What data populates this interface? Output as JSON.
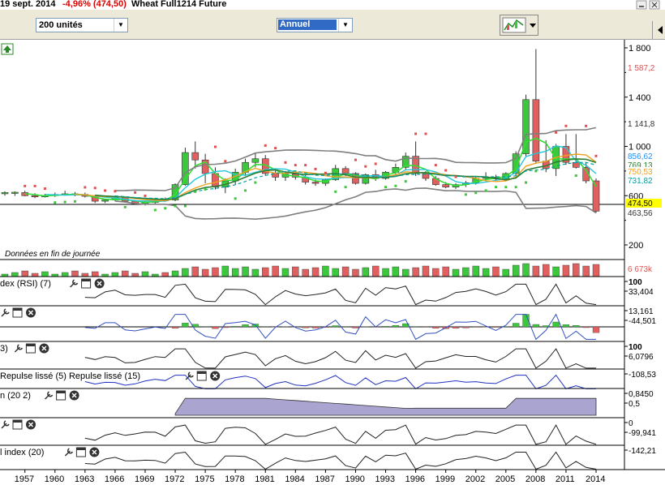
{
  "header": {
    "date": "19 sept. 2014",
    "change": "-4,96% (474,50)",
    "instrument": "Wheat Full1214 Future"
  },
  "toolbar": {
    "units_select": "200 unités",
    "period_select": "Annuel"
  },
  "colors": {
    "up": "#3cc83c",
    "down": "#e06060",
    "bollinger": "#7f7f7f",
    "sar": "#e05050",
    "ma_green": "#33dd33",
    "ma_dark": "#2e7d32",
    "ma_orange": "#f0a020",
    "ma_cyan": "#26c6da",
    "ma_dash": "#00a0a0",
    "indicator_fill": "#a9a4d0"
  },
  "main": {
    "footnote": "Données en fin de journée",
    "y_ticks": [
      "1 800",
      "1 400",
      "1 000",
      "600",
      "200"
    ],
    "price_labels": [
      {
        "text": "1 587,2",
        "color": "#e05050",
        "bg": "#ffffff"
      },
      {
        "text": "1 141,8",
        "color": "#333333",
        "bg": "#ffffff"
      },
      {
        "text": "856,62",
        "color": "#1e90ff",
        "bg": "#ffffff"
      },
      {
        "text": "769,13",
        "color": "#2e7d32",
        "bg": "#ffffff"
      },
      {
        "text": "750,53",
        "color": "#f0a020",
        "bg": "#ffffff"
      },
      {
        "text": "731,82",
        "color": "#00a0a0",
        "bg": "#ffffff"
      },
      {
        "text": "474,50",
        "color": "#000000",
        "bg": "#ffff00"
      },
      {
        "text": "463,56",
        "color": "#333333",
        "bg": "#ffffff"
      }
    ]
  },
  "volume": {
    "label": "6 673k"
  },
  "panels": [
    {
      "id": "rsi",
      "title": "dex (RSI) (7)",
      "values": [
        "100",
        "33,404"
      ]
    },
    {
      "id": "macd",
      "title": "",
      "values": [
        "13,161",
        "-44,501"
      ]
    },
    {
      "id": "stoch",
      "title": "3)",
      "values": [
        "100",
        "6,0796"
      ]
    },
    {
      "id": "repulse",
      "title": "Repulse lissé (5) Repulse lissé (15)",
      "values": [
        "-108,53"
      ]
    },
    {
      "id": "aroon",
      "title": "n (20 2)",
      "values": [
        "0,8450",
        "0,5"
      ]
    },
    {
      "id": "cci",
      "title": "",
      "values": [
        "0",
        "-99,941"
      ]
    },
    {
      "id": "index",
      "title": "l index (20)",
      "values": [
        "-142,21"
      ]
    }
  ],
  "xaxis": {
    "labels": [
      "1957",
      "1960",
      "1963",
      "1966",
      "1969",
      "1972",
      "1975",
      "1978",
      "1981",
      "1984",
      "1987",
      "1990",
      "1993",
      "1996",
      "1999",
      "2002",
      "2005",
      "2008",
      "2011",
      "2014"
    ]
  },
  "chart_data": {
    "type": "candlestick",
    "x_unit": "year",
    "ylim": [
      100,
      1850
    ],
    "candles": [
      {
        "year": 1955,
        "o": 620,
        "h": 635,
        "l": 600,
        "c": 625
      },
      {
        "year": 1956,
        "o": 620,
        "h": 635,
        "l": 598,
        "c": 628
      },
      {
        "year": 1957,
        "o": 625,
        "h": 640,
        "l": 595,
        "c": 600
      },
      {
        "year": 1958,
        "o": 600,
        "h": 620,
        "l": 580,
        "c": 595
      },
      {
        "year": 1959,
        "o": 595,
        "h": 615,
        "l": 585,
        "c": 600
      },
      {
        "year": 1960,
        "o": 600,
        "h": 625,
        "l": 590,
        "c": 610
      },
      {
        "year": 1961,
        "o": 610,
        "h": 640,
        "l": 600,
        "c": 615
      },
      {
        "year": 1962,
        "o": 615,
        "h": 630,
        "l": 595,
        "c": 610
      },
      {
        "year": 1963,
        "o": 610,
        "h": 625,
        "l": 585,
        "c": 595
      },
      {
        "year": 1964,
        "o": 595,
        "h": 605,
        "l": 540,
        "c": 555
      },
      {
        "year": 1965,
        "o": 555,
        "h": 575,
        "l": 540,
        "c": 565
      },
      {
        "year": 1966,
        "o": 565,
        "h": 600,
        "l": 555,
        "c": 585
      },
      {
        "year": 1967,
        "o": 585,
        "h": 590,
        "l": 545,
        "c": 555
      },
      {
        "year": 1968,
        "o": 555,
        "h": 565,
        "l": 525,
        "c": 535
      },
      {
        "year": 1969,
        "o": 535,
        "h": 560,
        "l": 520,
        "c": 545
      },
      {
        "year": 1970,
        "o": 545,
        "h": 580,
        "l": 535,
        "c": 570
      },
      {
        "year": 1971,
        "o": 570,
        "h": 585,
        "l": 555,
        "c": 565
      },
      {
        "year": 1972,
        "o": 565,
        "h": 700,
        "l": 555,
        "c": 690
      },
      {
        "year": 1973,
        "o": 690,
        "h": 990,
        "l": 680,
        "c": 950
      },
      {
        "year": 1974,
        "o": 950,
        "h": 1040,
        "l": 820,
        "c": 890
      },
      {
        "year": 1975,
        "o": 890,
        "h": 940,
        "l": 700,
        "c": 780
      },
      {
        "year": 1976,
        "o": 780,
        "h": 830,
        "l": 650,
        "c": 670
      },
      {
        "year": 1977,
        "o": 670,
        "h": 740,
        "l": 620,
        "c": 720
      },
      {
        "year": 1978,
        "o": 720,
        "h": 820,
        "l": 690,
        "c": 790
      },
      {
        "year": 1979,
        "o": 790,
        "h": 900,
        "l": 760,
        "c": 870
      },
      {
        "year": 1980,
        "o": 870,
        "h": 950,
        "l": 830,
        "c": 900
      },
      {
        "year": 1981,
        "o": 900,
        "h": 930,
        "l": 760,
        "c": 780
      },
      {
        "year": 1982,
        "o": 780,
        "h": 820,
        "l": 720,
        "c": 750
      },
      {
        "year": 1983,
        "o": 750,
        "h": 800,
        "l": 720,
        "c": 775
      },
      {
        "year": 1984,
        "o": 775,
        "h": 800,
        "l": 730,
        "c": 750
      },
      {
        "year": 1985,
        "o": 750,
        "h": 770,
        "l": 690,
        "c": 710
      },
      {
        "year": 1986,
        "o": 710,
        "h": 730,
        "l": 680,
        "c": 700
      },
      {
        "year": 1987,
        "o": 700,
        "h": 740,
        "l": 680,
        "c": 730
      },
      {
        "year": 1988,
        "o": 730,
        "h": 850,
        "l": 720,
        "c": 820
      },
      {
        "year": 1989,
        "o": 820,
        "h": 840,
        "l": 760,
        "c": 780
      },
      {
        "year": 1990,
        "o": 780,
        "h": 790,
        "l": 690,
        "c": 700
      },
      {
        "year": 1991,
        "o": 700,
        "h": 780,
        "l": 690,
        "c": 770
      },
      {
        "year": 1992,
        "o": 770,
        "h": 810,
        "l": 720,
        "c": 740
      },
      {
        "year": 1993,
        "o": 740,
        "h": 800,
        "l": 730,
        "c": 790
      },
      {
        "year": 1994,
        "o": 790,
        "h": 860,
        "l": 770,
        "c": 830
      },
      {
        "year": 1995,
        "o": 830,
        "h": 950,
        "l": 810,
        "c": 920
      },
      {
        "year": 1996,
        "o": 920,
        "h": 1040,
        "l": 760,
        "c": 780
      },
      {
        "year": 1997,
        "o": 780,
        "h": 800,
        "l": 720,
        "c": 740
      },
      {
        "year": 1998,
        "o": 740,
        "h": 760,
        "l": 680,
        "c": 690
      },
      {
        "year": 1999,
        "o": 690,
        "h": 710,
        "l": 660,
        "c": 670
      },
      {
        "year": 2000,
        "o": 670,
        "h": 700,
        "l": 655,
        "c": 690
      },
      {
        "year": 2001,
        "o": 690,
        "h": 720,
        "l": 670,
        "c": 705
      },
      {
        "year": 2002,
        "o": 705,
        "h": 760,
        "l": 690,
        "c": 740
      },
      {
        "year": 2003,
        "o": 740,
        "h": 790,
        "l": 720,
        "c": 750
      },
      {
        "year": 2004,
        "o": 750,
        "h": 770,
        "l": 720,
        "c": 735
      },
      {
        "year": 2005,
        "o": 735,
        "h": 790,
        "l": 720,
        "c": 780
      },
      {
        "year": 2006,
        "o": 780,
        "h": 960,
        "l": 760,
        "c": 940
      },
      {
        "year": 2007,
        "o": 940,
        "h": 1420,
        "l": 920,
        "c": 1380
      },
      {
        "year": 2008,
        "o": 1380,
        "h": 1790,
        "l": 860,
        "c": 880
      },
      {
        "year": 2009,
        "o": 880,
        "h": 1050,
        "l": 790,
        "c": 820
      },
      {
        "year": 2010,
        "o": 820,
        "h": 1020,
        "l": 760,
        "c": 1000
      },
      {
        "year": 2011,
        "o": 1000,
        "h": 1100,
        "l": 850,
        "c": 870
      },
      {
        "year": 2012,
        "o": 870,
        "h": 1100,
        "l": 820,
        "c": 830
      },
      {
        "year": 2013,
        "o": 830,
        "h": 870,
        "l": 700,
        "c": 720
      },
      {
        "year": 2014,
        "o": 720,
        "h": 740,
        "l": 460,
        "c": 474.5
      }
    ]
  }
}
